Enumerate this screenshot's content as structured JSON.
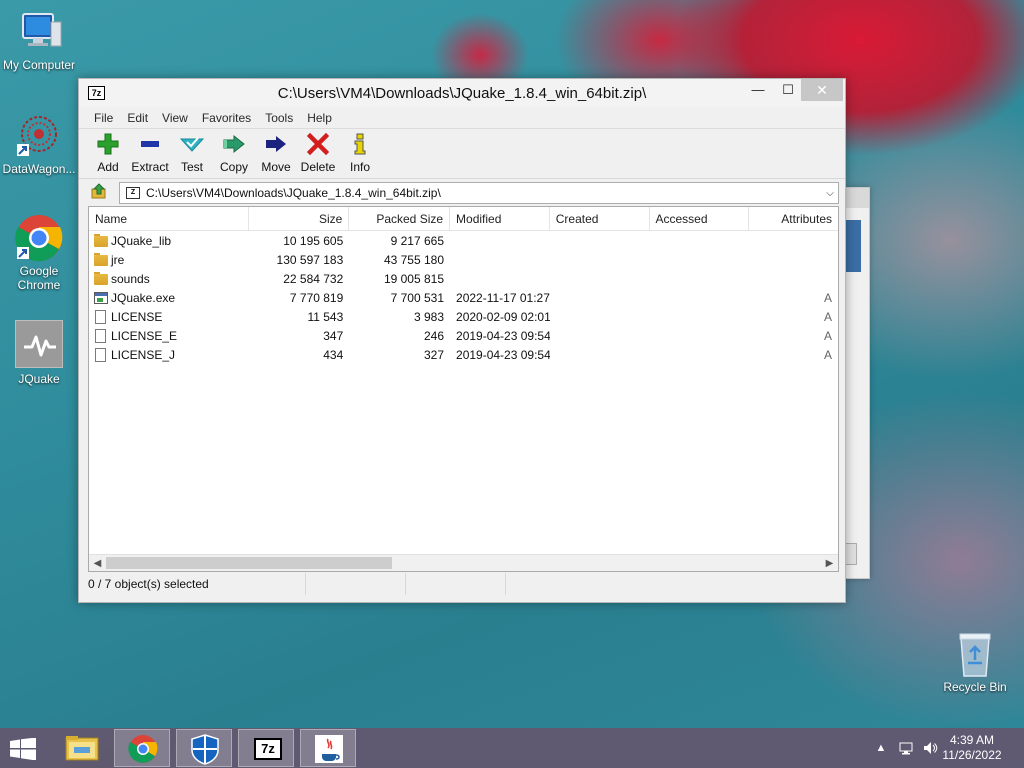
{
  "desktop": {
    "icons": [
      {
        "label": "My Computer"
      },
      {
        "label": "DataWagon..."
      },
      {
        "label": "Google Chrome"
      },
      {
        "label": "JQuake"
      },
      {
        "label": "Recycle Bin"
      }
    ]
  },
  "window": {
    "app_icon": "7z",
    "title": "C:\\Users\\VM4\\Downloads\\JQuake_1.8.4_win_64bit.zip\\",
    "controls": {
      "minimize": "—",
      "maximize": "☐",
      "close": "✕"
    }
  },
  "menu": [
    "File",
    "Edit",
    "View",
    "Favorites",
    "Tools",
    "Help"
  ],
  "toolbar": [
    {
      "label": "Add",
      "icon": "plus-icon",
      "color": "#2aa12a"
    },
    {
      "label": "Extract",
      "icon": "minus-icon",
      "color": "#1f35a8"
    },
    {
      "label": "Test",
      "icon": "check-icon",
      "color": "#2fb3c4"
    },
    {
      "label": "Copy",
      "icon": "double-arrow-icon",
      "color": "#2a9a6a"
    },
    {
      "label": "Move",
      "icon": "arrow-right-icon",
      "color": "#1a237e"
    },
    {
      "label": "Delete",
      "icon": "x-icon",
      "color": "#d21e1e"
    },
    {
      "label": "Info",
      "icon": "info-icon",
      "color": "#e8d400"
    }
  ],
  "address": {
    "path": "C:\\Users\\VM4\\Downloads\\JQuake_1.8.4_win_64bit.zip\\"
  },
  "columns": [
    "Name",
    "Size",
    "Packed Size",
    "Modified",
    "Created",
    "Accessed",
    "Attributes"
  ],
  "files": [
    {
      "name": "JQuake_lib",
      "type": "folder",
      "size": "10 195 605",
      "packed": "9 217 665",
      "modified": "",
      "attr": ""
    },
    {
      "name": "jre",
      "type": "folder",
      "size": "130 597 183",
      "packed": "43 755 180",
      "modified": "",
      "attr": ""
    },
    {
      "name": "sounds",
      "type": "folder",
      "size": "22 584 732",
      "packed": "19 005 815",
      "modified": "",
      "attr": ""
    },
    {
      "name": "JQuake.exe",
      "type": "exe",
      "size": "7 770 819",
      "packed": "7 700 531",
      "modified": "2022-11-17 01:27",
      "attr": "A"
    },
    {
      "name": "LICENSE",
      "type": "file",
      "size": "11 543",
      "packed": "3 983",
      "modified": "2020-02-09 02:01",
      "attr": "A"
    },
    {
      "name": "LICENSE_E",
      "type": "file",
      "size": "347",
      "packed": "246",
      "modified": "2019-04-23 09:54",
      "attr": "A"
    },
    {
      "name": "LICENSE_J",
      "type": "file",
      "size": "434",
      "packed": "327",
      "modified": "2019-04-23 09:54",
      "attr": "A"
    }
  ],
  "status": {
    "selection": "0 / 7 object(s) selected"
  },
  "taskbar": {
    "items": [
      {
        "name": "file-explorer"
      },
      {
        "name": "chrome"
      },
      {
        "name": "windows-defender"
      },
      {
        "name": "7-zip",
        "label": "7z"
      },
      {
        "name": "java"
      }
    ],
    "time": "4:39 AM",
    "date": "11/26/2022"
  }
}
